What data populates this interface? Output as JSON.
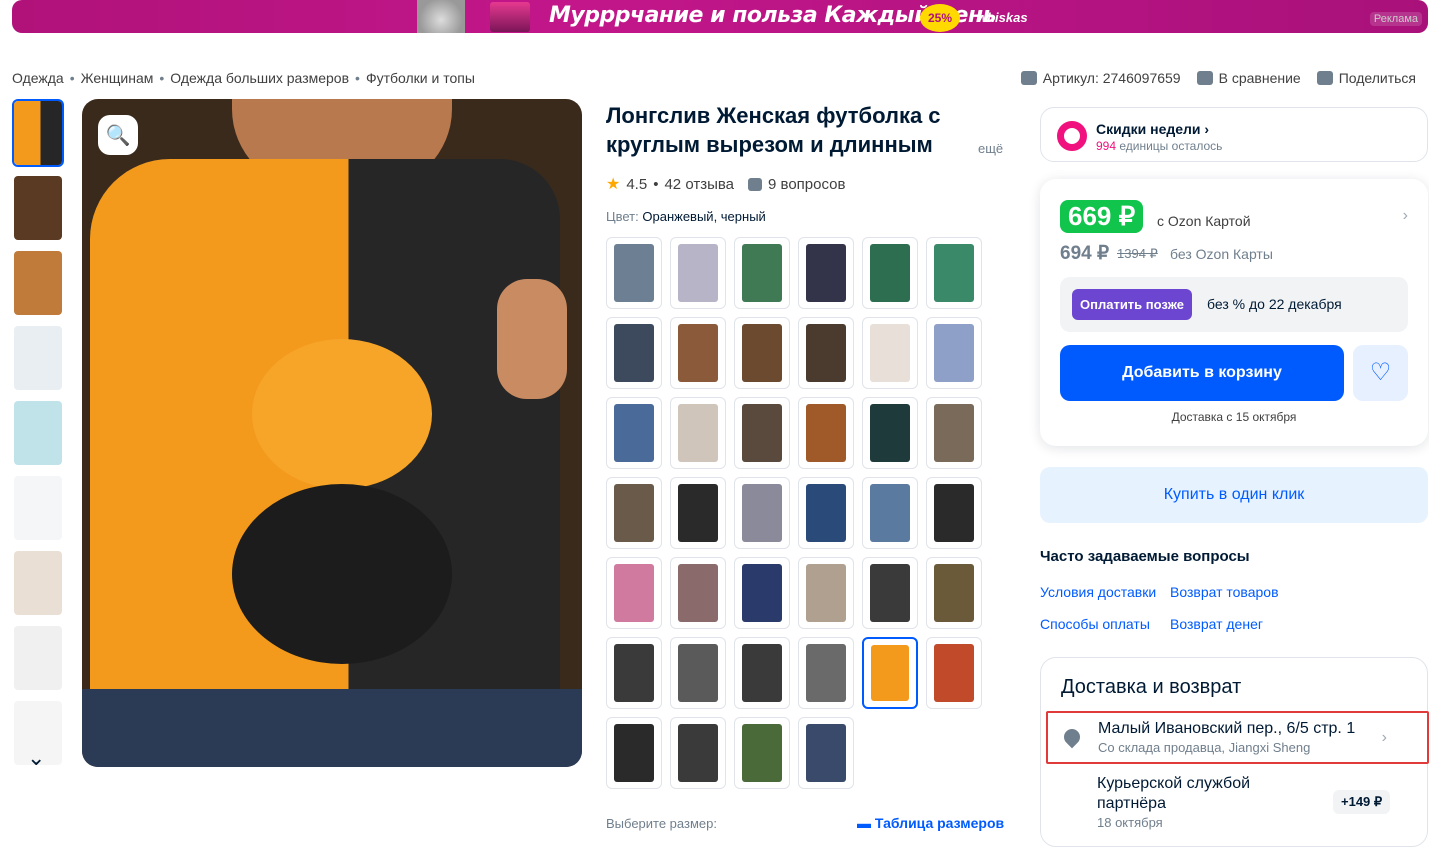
{
  "banner": {
    "text": "Мурррчание и польза  Каждый день",
    "badge": "25%",
    "brand": "whiskas",
    "ad_label": "Реклама"
  },
  "breadcrumbs": [
    "Одежда",
    "Женщинам",
    "Одежда больших размеров",
    "Футболки и топы"
  ],
  "top_actions": {
    "article": "Артикул: 2746097659",
    "compare": "В сравнение",
    "share": "Поделиться"
  },
  "product": {
    "title": "Лонгслив Женская футболка с круглым вырезом и длинным",
    "more": "ещё",
    "rating": "4.5",
    "reviews": "42 отзыва",
    "questions": "9 вопросов",
    "color_label": "Цвет:",
    "color_value": "Оранжевый, черный",
    "size_label": "Выберите размер:",
    "size_table": "Таблица размеров"
  },
  "thumb_colors": [
    "#f39a1d",
    "#5a3a22",
    "#c07a3a",
    "#e8eef2",
    "#bfe3e8",
    "#f4f6f8",
    "#eadfd5",
    "#f0f0f0",
    "#f5f5f5"
  ],
  "swatch_colors": [
    "#6d7f93",
    "#b7b4c8",
    "#3f7a55",
    "#33334a",
    "#2e6e50",
    "#3a8a6a",
    "#3d4a5e",
    "#8a5a3a",
    "#6b4a30",
    "#4a3b2e",
    "#e8e0d8",
    "#8fa0c8",
    "#4a6a9a",
    "#cfc5bb",
    "#5a4a3e",
    "#a05a2a",
    "#1f3a3a",
    "#7a6a5a",
    "#6a5a4a",
    "#2a2a2a",
    "#8a8a9a",
    "#2a4a7a",
    "#5a7aa0",
    "#2a2a2a",
    "#d07aa0",
    "#8a6a6a",
    "#2a3a6a",
    "#b0a090",
    "#3a3a3a",
    "#6a5a3a",
    "#3a3a3a",
    "#5a5a5a",
    "#3a3a3a",
    "#6a6a6a",
    "#f39a1d",
    "#c04a2a",
    "#2a2a2a",
    "#3a3a3a",
    "#4a6a3a",
    "#3a4a6a"
  ],
  "sale": {
    "title": "Скидки недели",
    "count": "994",
    "rest": " единицы осталось"
  },
  "price": {
    "main": "669 ₽",
    "with_card": "с Ozon Картой",
    "old": "694 ₽",
    "strike": "1394 ₽",
    "no_card": "без Ozon Карты",
    "pay_later": "Оплатить позже",
    "pay_later_text": "без % до 22 декабря",
    "add_cart": "Добавить в корзину",
    "delivery": "Доставка с 15 октября"
  },
  "one_click": "Купить в один клик",
  "faq": {
    "title": "Часто задаваемые вопросы",
    "items": [
      "Условия доставки",
      "Возврат товаров",
      "Способы оплаты",
      "Возврат денег"
    ]
  },
  "delivery": {
    "title": "Доставка и возврат",
    "address": "Малый Ивановский пер., 6/5 стр. 1",
    "warehouse": "Со склада продавца, Jiangxi Sheng",
    "courier": "Курьерской службой партнёра",
    "courier_date": "18 октября",
    "courier_price": "+149 ₽"
  }
}
